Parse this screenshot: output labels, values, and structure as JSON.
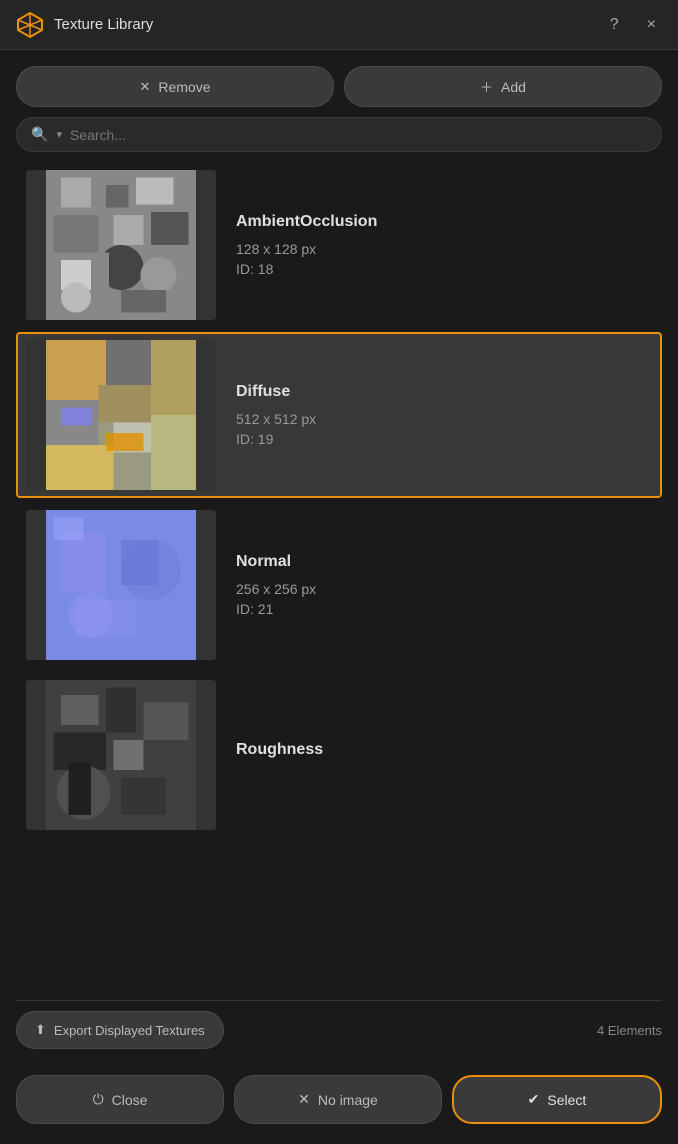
{
  "window": {
    "title": "Texture Library",
    "help_btn": "?",
    "close_btn": "×"
  },
  "toolbar": {
    "remove_label": "Remove",
    "add_label": "Add"
  },
  "search": {
    "placeholder": "Search...",
    "icon": "🔍",
    "dropdown_icon": "▾"
  },
  "textures": [
    {
      "id": "ambient-occlusion",
      "name": "AmbientOcclusion",
      "dimensions": "128 x 128 px",
      "texture_id": "ID: 18",
      "selected": false,
      "thumb_type": "ao"
    },
    {
      "id": "diffuse",
      "name": "Diffuse",
      "dimensions": "512 x 512 px",
      "texture_id": "ID: 19",
      "selected": true,
      "thumb_type": "diffuse"
    },
    {
      "id": "normal",
      "name": "Normal",
      "dimensions": "256 x 256 px",
      "texture_id": "ID: 21",
      "selected": false,
      "thumb_type": "normal"
    },
    {
      "id": "roughness",
      "name": "Roughness",
      "dimensions": "",
      "texture_id": "",
      "selected": false,
      "thumb_type": "roughness"
    }
  ],
  "bottom_bar": {
    "export_label": "Export Displayed Textures",
    "elements_count": "4 Elements"
  },
  "footer": {
    "close_label": "Close",
    "no_image_label": "No image",
    "select_label": "Select"
  }
}
